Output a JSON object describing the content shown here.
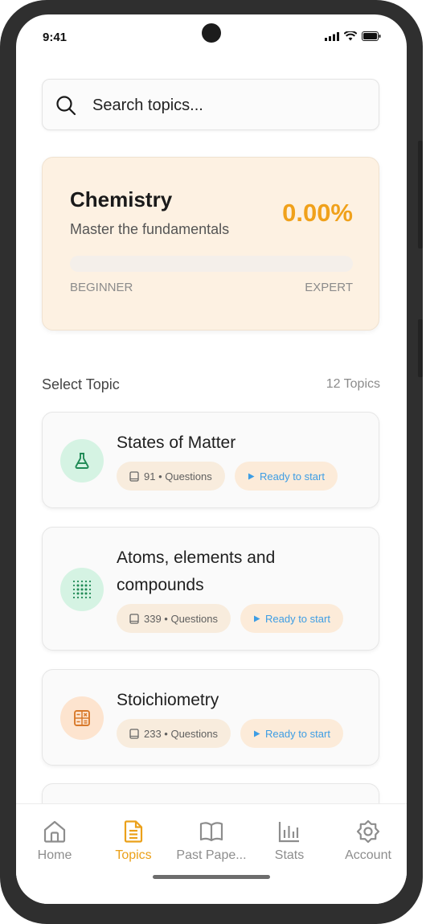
{
  "status_bar": {
    "time": "9:41"
  },
  "search": {
    "placeholder": "Search topics..."
  },
  "course": {
    "title": "Chemistry",
    "subtitle": "Master the fundamentals",
    "progress_label": "0.00%",
    "progress_fraction": 0.0,
    "level_start": "BEGINNER",
    "level_end": "EXPERT",
    "accent_color": "#f0a11b"
  },
  "topics_section": {
    "title": "Select Topic",
    "count": "12 Topics"
  },
  "topics": [
    {
      "name": "States of Matter",
      "questions": "91 • Questions",
      "status": "Ready to start",
      "icon": "flask-icon"
    },
    {
      "name": "Atoms, elements and compounds",
      "questions": "339 • Questions",
      "status": "Ready to start",
      "icon": "atom-grid-icon"
    },
    {
      "name": "Stoichiometry",
      "questions": "233 • Questions",
      "status": "Ready to start",
      "icon": "calculator-icon"
    }
  ],
  "bottom_nav": [
    {
      "label": "Home",
      "icon": "home-icon",
      "active": false
    },
    {
      "label": "Topics",
      "icon": "document-icon",
      "active": true
    },
    {
      "label": "Past Pape...",
      "icon": "book-icon",
      "active": false
    },
    {
      "label": "Stats",
      "icon": "bar-chart-icon",
      "active": false
    },
    {
      "label": "Account",
      "icon": "gear-icon",
      "active": false
    }
  ]
}
